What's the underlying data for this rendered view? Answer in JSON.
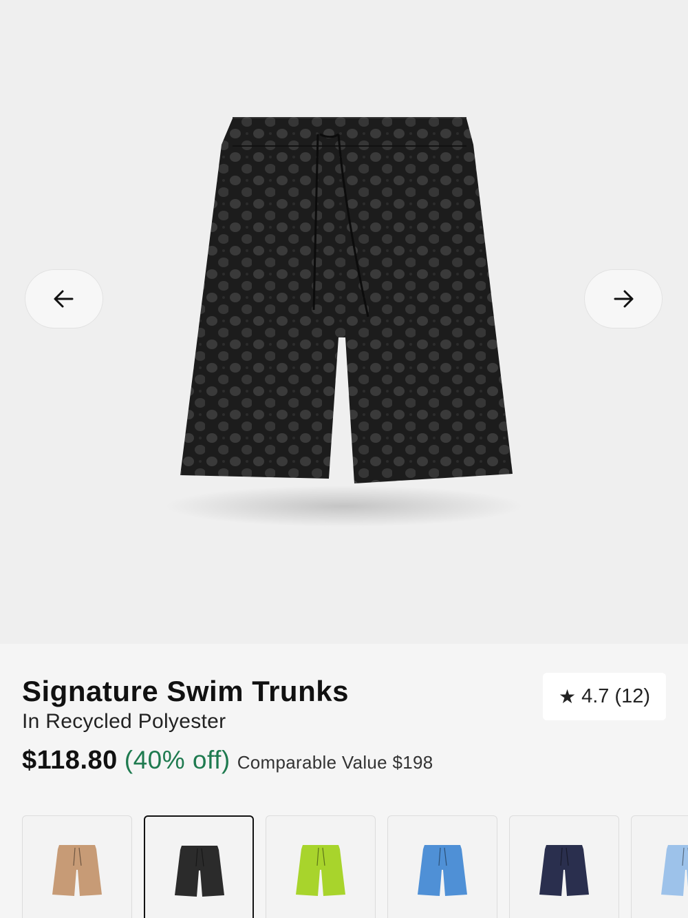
{
  "gallery": {
    "prev_icon": "arrow-left-icon",
    "next_icon": "arrow-right-icon",
    "image_subject": "black signature print swim trunks"
  },
  "product": {
    "title": "Signature Swim Trunks",
    "subtitle": "In Recycled Polyester",
    "rating": {
      "star_icon": "star-icon",
      "value": "4.7",
      "count": "(12)"
    },
    "price": "$118.80",
    "discount": "(40% off)",
    "comparable": "Comparable Value $198",
    "colors": {
      "discount": "#1e7a4f"
    }
  },
  "swatches": [
    {
      "color": "#c79b76",
      "selected": false
    },
    {
      "color": "#2b2b2b",
      "selected": true
    },
    {
      "color": "#a8d42c",
      "selected": false
    },
    {
      "color": "#4f90d6",
      "selected": false
    },
    {
      "color": "#2a2f4e",
      "selected": false
    },
    {
      "color": "#9dc2ea",
      "selected": false
    }
  ]
}
